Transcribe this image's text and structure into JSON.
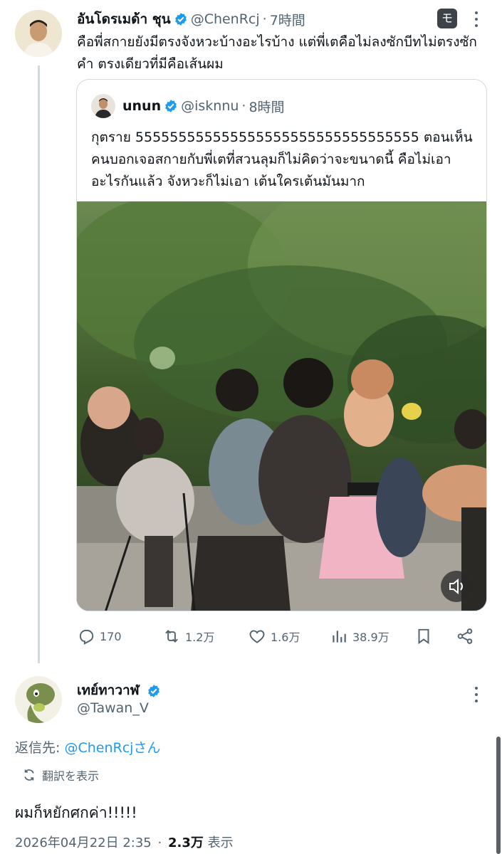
{
  "tweet": {
    "display_name": "อันโดรเมด้า ชุน",
    "handle": "@ChenRcj",
    "separator": "·",
    "time": "7時間",
    "ext_badge": "モ",
    "text": "คือพี่สกายยังมีตรงจังหวะบ้างอะไรบ้าง แต่พี่เตคือไม่ลงซักบีทไม่ตรงซักคำ ตรงเดียวที่มีคือเส้นผม"
  },
  "quote": {
    "display_name": "unun",
    "handle": "@isknnu",
    "separator": "·",
    "time": "8時間",
    "text": "กุตราย 555555555555555555555555555555555 ตอนเห็นคนบอกเจอสกายกับพี่เตที่สวนลุมก็ไม่คิดว่าจะขนาดนี้ คือไม่เอาอะไรกันแล้ว จังหวะก็ไม่เอา เต้นใครเต้นมันมาก"
  },
  "actions": {
    "replies": "170",
    "reposts": "1.2万",
    "likes": "1.6万",
    "views": "38.9万"
  },
  "reply": {
    "display_name": "เทย์ทาวาฬ",
    "handle": "@Tawan_V",
    "replying_prefix": "返信先: ",
    "replying_mention": "@ChenRcj",
    "replying_suffix": "さん",
    "translate_label": "翻訳を表示",
    "text": "ผมก็หยักศกค่า!!!!!",
    "date": "2026年04月22日 2:35",
    "separator": "·",
    "views_count": "2.3万",
    "views_label": "表示"
  },
  "colors": {
    "verified": "#1d9bf0",
    "link": "#1d9bf0",
    "muted_text": "#536471"
  },
  "icons": [
    "verified-badge-icon",
    "more-icon",
    "reply-icon",
    "repost-icon",
    "like-icon",
    "views-icon",
    "bookmark-icon",
    "share-icon",
    "speaker-icon",
    "translate-icon"
  ]
}
